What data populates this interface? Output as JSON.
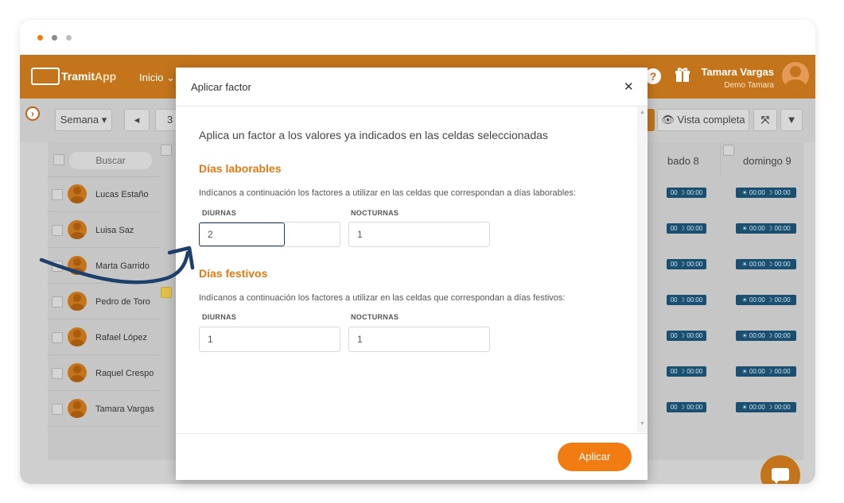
{
  "app": {
    "logo_a": "Tramit",
    "logo_b": "App",
    "nav_inicio": "Inicio",
    "help_icon": "?",
    "user_name": "Tamara Vargas",
    "user_sub": "Demo Tamara"
  },
  "toolbar": {
    "semana": "Semana ▾",
    "prev": "◂",
    "date_frag": "3",
    "vista": "Vista completa"
  },
  "grid": {
    "search": "Buscar",
    "col_sabado": "bado 8",
    "col_domingo": "domingo 9",
    "shift_partial": "00  ☽ 00:00",
    "shift_full": "☀ 00:00  ☽ 00:00",
    "rows": [
      {
        "name": "Lucas Estaño"
      },
      {
        "name": "Luisa Saz"
      },
      {
        "name": "Marta Garrido"
      },
      {
        "name": "Pedro de Toro"
      },
      {
        "name": "Rafael López"
      },
      {
        "name": "Raquel Crespo"
      },
      {
        "name": "Tamara Vargas"
      }
    ]
  },
  "modal": {
    "title": "Aplicar factor",
    "close": "✕",
    "intro": "Aplica un factor a los valores ya indicados en las celdas seleccionadas",
    "laborables": {
      "title": "Días laborables",
      "desc": "Indícanos a continuación los factores a utilizar en las celdas que correspondan a días laborables:",
      "diurnas_label": "DIURNAS",
      "diurnas_value": "2",
      "nocturnas_label": "NOCTURNAS",
      "nocturnas_value": "1"
    },
    "festivos": {
      "title": "Días festivos",
      "desc": "Indícanos a continuación los factores a utilizar en las celdas que correspondan a días festivos:",
      "diurnas_label": "DIURNAS",
      "diurnas_value": "1",
      "nocturnas_label": "NOCTURNAS",
      "nocturnas_value": "1"
    },
    "apply": "Aplicar"
  },
  "colors": {
    "brand": "#f07c12",
    "brand_dim": "#c4751b",
    "section_title": "#e27a14",
    "shift_badge": "#1a4f70",
    "arrow": "#1d3f6b"
  }
}
